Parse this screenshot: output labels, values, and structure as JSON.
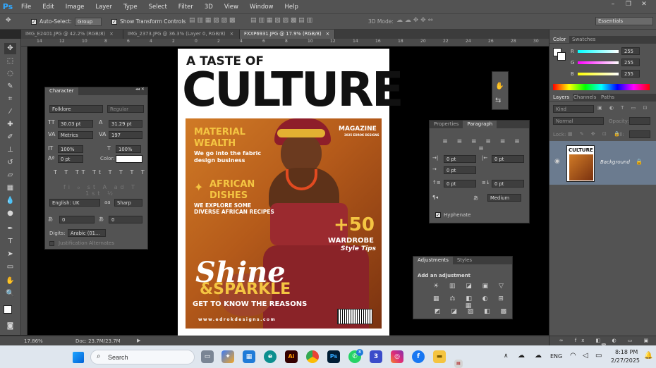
{
  "app": {
    "logo": "Ps",
    "menu": [
      "File",
      "Edit",
      "Image",
      "Layer",
      "Type",
      "Select",
      "Filter",
      "3D",
      "View",
      "Window",
      "Help"
    ]
  },
  "options_bar": {
    "auto_select_label": "Auto-Select:",
    "auto_select_value": "Group",
    "transform_label": "Show Transform Controls",
    "mode_3d": "3D Mode:",
    "workspace": "Essentials"
  },
  "doc_tabs": [
    {
      "label": "IMG_E2401.JPG @ 42.2% (RGB/8)",
      "close": "×"
    },
    {
      "label": "IMG_2373.JPG @ 36.3% (Layer 0, RGB/8)",
      "close": "×"
    },
    {
      "label": "FXXP6931.JPG @ 17.9% (RGB/8)",
      "close": "×"
    }
  ],
  "ruler_ticks": [
    "14",
    "12",
    "10",
    "8",
    "6",
    "4",
    "2",
    "0",
    "2",
    "4",
    "6",
    "8",
    "10",
    "12",
    "14",
    "16",
    "18",
    "20",
    "22",
    "24",
    "26",
    "28",
    "30"
  ],
  "status": {
    "zoom": "17.86%",
    "doc": "Doc: 23.7M/23.7M"
  },
  "character_panel": {
    "tab": "Character",
    "font_family": "Folklore",
    "font_style": "Regular",
    "size": "30.03 pt",
    "leading": "31.29 pt",
    "kerning": "Metrics",
    "tracking": "197",
    "vscale": "100%",
    "hscale": "100%",
    "baseline": "0 pt",
    "color_label": "Color:",
    "language": "English: UK",
    "aa_prefix": "aa",
    "antialias": "Sharp",
    "field_a": "0",
    "field_b": "0",
    "digits_label": "Digits:",
    "digits_value": "Arabic (01...",
    "justification": "Justification Alternates",
    "type_buttons": [
      "T",
      "T",
      "TT",
      "Tt",
      "T",
      "T",
      "T",
      "T"
    ]
  },
  "paragraph_panel": {
    "tabs": [
      "Properties",
      "Paragraph"
    ],
    "indent_left": "0 pt",
    "indent_right": "0 pt",
    "first_line": "0 pt",
    "space_before": "0 pt",
    "space_after": "0 pt",
    "composer": "Medium",
    "hyphenate": "Hyphenate"
  },
  "adjustments_panel": {
    "tabs": [
      "Adjustments",
      "Styles"
    ],
    "title": "Add an adjustment"
  },
  "color_panel": {
    "tabs": [
      "Color",
      "Swatches"
    ],
    "channels": [
      {
        "name": "R",
        "value": "255",
        "color": "#ff3c3c"
      },
      {
        "name": "G",
        "value": "255",
        "color": "#3cff3c"
      },
      {
        "name": "B",
        "value": "255",
        "color": "#5a7bff"
      }
    ]
  },
  "layers_panel": {
    "tabs": [
      "Layers",
      "Channels",
      "Paths"
    ],
    "filter": "Kind",
    "blend": "Normal",
    "opacity_label": "Opacity:",
    "lock_label": "Lock:",
    "fill_label": "Fill:",
    "layer_name": "Background"
  },
  "magazine": {
    "top_line": "A TASTE OF",
    "main_title": "CULTURE",
    "label": "MAGAZINE",
    "label_sub": "2025 EDROK DESIGNS",
    "h1": "MATERIAL",
    "h1b": "WEALTH",
    "s1": "We go into the fabric",
    "s1b": "design business",
    "h2": "AFRICAN",
    "h2b": "DISHES",
    "s2": "WE EXPLORE SOME",
    "s2b": "DIVERSE AFRICAN RECIPES",
    "num": "+50",
    "wardrobe": "WARDROBE",
    "style_tips": "Style Tips",
    "shine": "Shine",
    "sparkle": "&SPARKLE",
    "reasons": "GET TO KNOW THE REASONS",
    "website": "www.edrokdesigns.com"
  },
  "taskbar": {
    "search": "Search",
    "lang": "ENG",
    "time": "8:18 PM",
    "date": "2/27/2025",
    "badge": "8"
  },
  "colors": {
    "accent": "#31a8ff",
    "cover_yellow": "#f4c542",
    "cover_red": "#9b2a2f"
  }
}
